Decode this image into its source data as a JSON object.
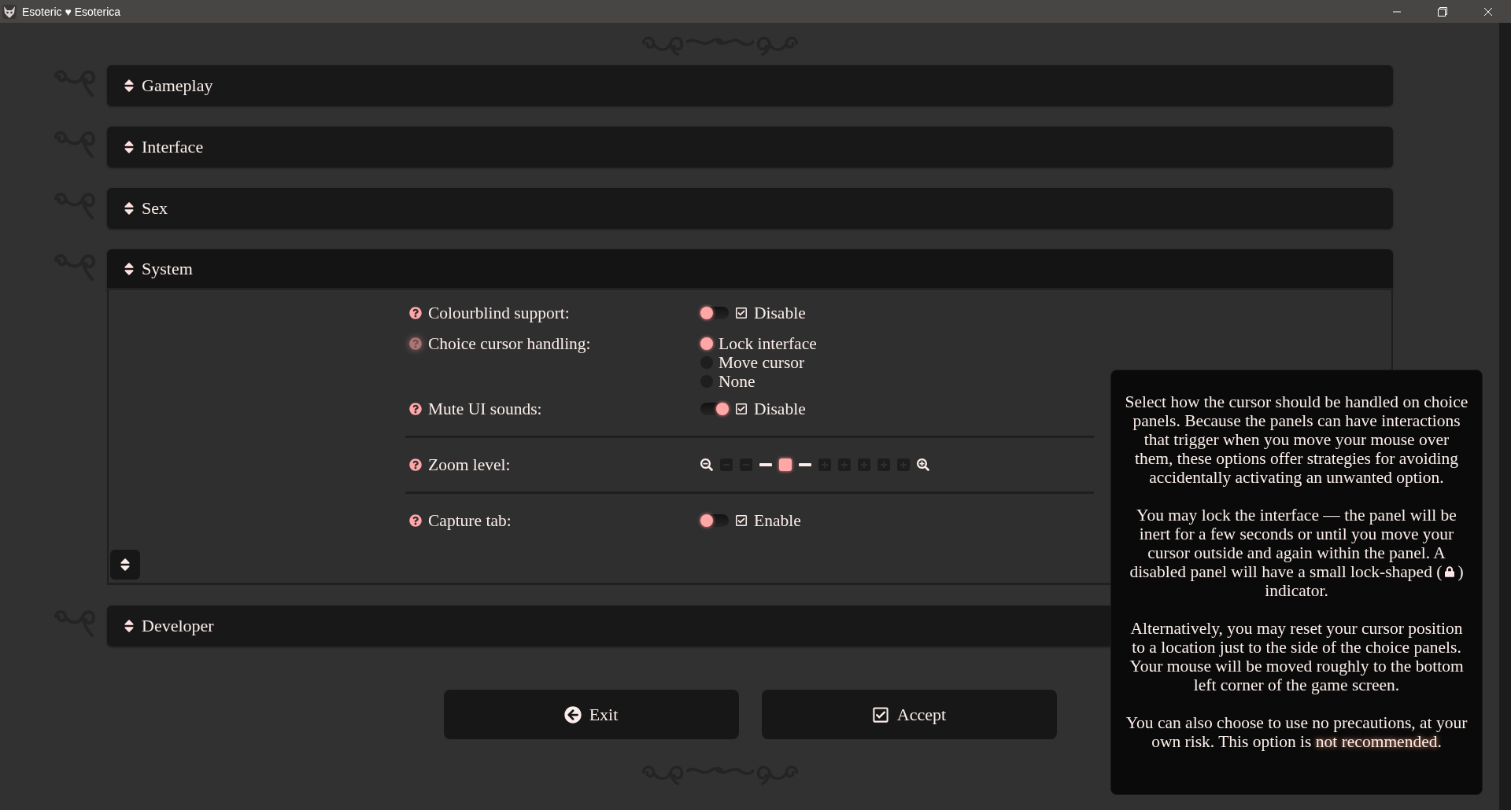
{
  "window": {
    "title": "Esoteric ♥ Esoterica"
  },
  "sections": [
    {
      "title": "Gameplay",
      "expanded": false
    },
    {
      "title": "Interface",
      "expanded": false
    },
    {
      "title": "Sex",
      "expanded": false
    },
    {
      "title": "System",
      "expanded": true,
      "settings": [
        {
          "kind": "toggle",
          "label": "Colourblind support:",
          "help_active": false,
          "on": false,
          "checked": true,
          "option": "Disable"
        },
        {
          "kind": "radio",
          "label": "Choice cursor handling:",
          "help_active": true,
          "options": [
            {
              "label": "Lock interface",
              "selected": true
            },
            {
              "label": "Move cursor",
              "selected": false
            },
            {
              "label": "None",
              "selected": false
            }
          ]
        },
        {
          "kind": "toggle",
          "label": "Mute UI sounds:",
          "help_active": false,
          "on": true,
          "checked": true,
          "option": "Disable"
        },
        {
          "kind": "divider"
        },
        {
          "kind": "zoom",
          "label": "Zoom level:",
          "help_active": false,
          "steps": [
            {
              "kind": "minus"
            },
            {
              "kind": "minus"
            },
            {
              "kind": "dash"
            },
            {
              "kind": "current"
            },
            {
              "kind": "dash"
            },
            {
              "kind": "plus"
            },
            {
              "kind": "plus"
            },
            {
              "kind": "plus"
            },
            {
              "kind": "plus"
            },
            {
              "kind": "plus"
            }
          ]
        },
        {
          "kind": "divider"
        },
        {
          "kind": "toggle",
          "label": "Capture tab:",
          "help_active": false,
          "on": false,
          "checked": true,
          "option": "Enable"
        }
      ]
    },
    {
      "title": "Developer",
      "expanded": false
    }
  ],
  "buttons": [
    {
      "label": "Exit",
      "kind": "exit"
    },
    {
      "label": "Accept",
      "kind": "accept"
    }
  ],
  "tooltip": {
    "paragraph_1": "Select how the cursor should be handled on choice panels. Because the panels can have interactions that trigger when you move your mouse over them, these options offer strategies for avoiding accidentally activating an unwanted option.",
    "paragraph_2_start": "You may lock the interface — the panel will be inert for a few seconds or until you move your cursor outside and again within the panel. A",
    "paragraph_2_before": "disabled panel will have a small lock-shaped (",
    "paragraph_2_after": ")",
    "paragraph_2_end": "indicator.",
    "paragraph_3": "Alternatively, you may reset your cursor position to a location just to the side of the choice panels. Your mouse will be moved roughly to the bottom left corner of the game screen.",
    "paragraph_4": "You can also choose to use no precautions, at your own risk. This option is **not recommended**."
  }
}
